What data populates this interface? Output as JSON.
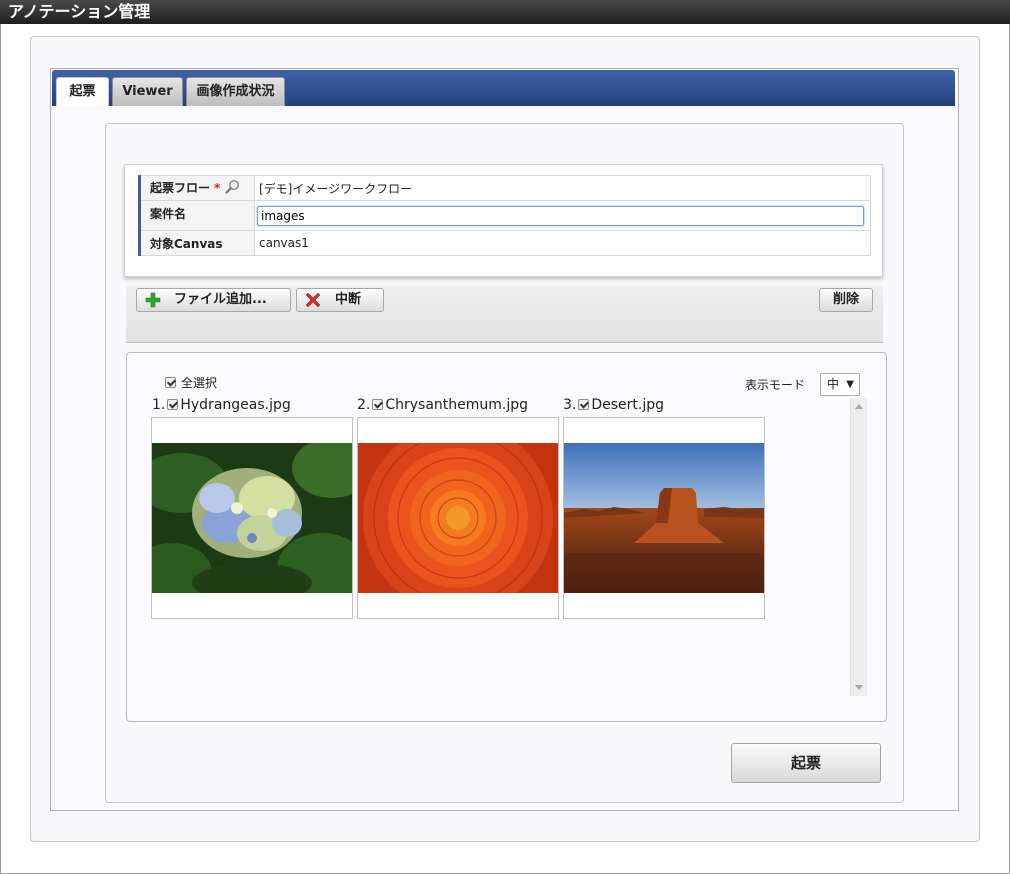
{
  "window": {
    "title": "アノテーション管理"
  },
  "tabs": [
    {
      "label": "起票",
      "active": true
    },
    {
      "label": "Viewer",
      "active": false
    },
    {
      "label": "画像作成状況",
      "active": false
    }
  ],
  "form": {
    "flow": {
      "label": "起票フロー",
      "required_mark": "*",
      "value": "[デモ]イメージワークフロー"
    },
    "subject": {
      "label": "案件名",
      "value": "images"
    },
    "canvas": {
      "label": "対象Canvas",
      "value": "canvas1"
    }
  },
  "toolbar": {
    "add_file_label": "ファイル追加...",
    "abort_label": "中断",
    "delete_label": "削除"
  },
  "files": {
    "select_all_label": "全選択",
    "display_mode_label": "表示モード",
    "display_mode_value": "中",
    "items": [
      {
        "index": "1.",
        "name": "Hydrangeas.jpg",
        "checked": true
      },
      {
        "index": "2.",
        "name": "Chrysanthemum.jpg",
        "checked": true
      },
      {
        "index": "3.",
        "name": "Desert.jpg",
        "checked": true
      }
    ]
  },
  "submit_label": "起票",
  "colors": {
    "tab_bar": "#2f4f93",
    "input_focus": "#6fa0de",
    "required": "#e02020"
  }
}
